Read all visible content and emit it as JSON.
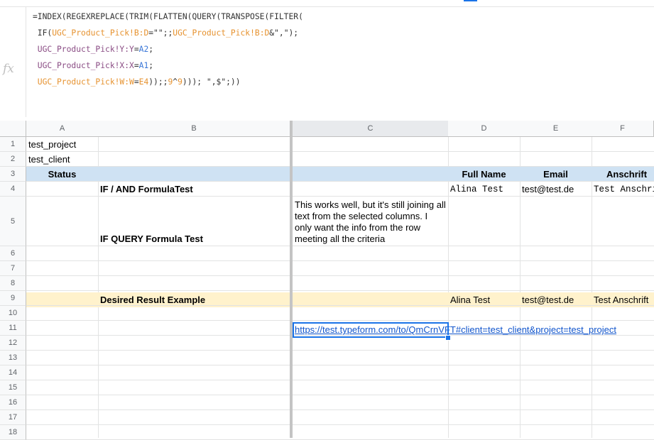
{
  "formula": {
    "fx_label": "fx",
    "lines": [
      [
        {
          "t": "=INDEX(REGEXREPLACE(TRIM(FLATTEN(QUERY(TRANSPOSE(FILTER(",
          "c": "txt"
        }
      ],
      [
        {
          "t": " IF(",
          "c": "txt"
        },
        {
          "t": "UGC_Product_Pick!B:D",
          "c": "org"
        },
        {
          "t": "=\"\";;",
          "c": "txt"
        },
        {
          "t": "UGC_Product_Pick!B:D",
          "c": "org"
        },
        {
          "t": "&\",\");",
          "c": "txt"
        }
      ],
      [
        {
          "t": " UGC_Product_Pick!Y:Y",
          "c": "pur"
        },
        {
          "t": "=",
          "c": "txt"
        },
        {
          "t": "A2",
          "c": "blu"
        },
        {
          "t": ";",
          "c": "txt"
        }
      ],
      [
        {
          "t": " UGC_Product_Pick!X:X",
          "c": "pur"
        },
        {
          "t": "=",
          "c": "txt"
        },
        {
          "t": "A1",
          "c": "blu"
        },
        {
          "t": ";",
          "c": "txt"
        }
      ],
      [
        {
          "t": " UGC_Product_Pick!W:W",
          "c": "org"
        },
        {
          "t": "=",
          "c": "txt"
        },
        {
          "t": "E4",
          "c": "org"
        },
        {
          "t": "));;",
          "c": "txt"
        },
        {
          "t": "9",
          "c": "org"
        },
        {
          "t": "^",
          "c": "txt"
        },
        {
          "t": "9",
          "c": "org"
        },
        {
          "t": "))); \",$\";))",
          "c": "txt"
        }
      ]
    ]
  },
  "columns": [
    "A",
    "B",
    "C",
    "D",
    "E",
    "F"
  ],
  "rows": [
    "1",
    "2",
    "3",
    "4",
    "5",
    "6",
    "7",
    "8",
    "9",
    "10",
    "11",
    "12",
    "13",
    "14",
    "15",
    "16",
    "17",
    "18"
  ],
  "cells": {
    "A1": "test_project",
    "A2": "test_client",
    "A3": "Status",
    "D3": "Full Name",
    "E3": "Email",
    "F3": "Anschrift",
    "B4": "IF / AND FormulaTest",
    "D4": "Alina Test",
    "E4": "test@test.de",
    "F4": "Test Anschrift",
    "B5": "IF QUERY Formula Test",
    "C5": "This works well, but it's still joining all text from the selected columns. I only want the info from the row meeting all the criteria",
    "B9": "Desired Result Example",
    "D9": "Alina Test",
    "E9": "test@test.de",
    "F9": "Test Anschrift",
    "C11": "https://test.typeform.com/to/QmCrnVFT#client=test_client&project=test_project"
  },
  "colors": {
    "header_band": "#cfe2f3",
    "result_band": "#fff2cc",
    "selection": "#1a73e8",
    "link": "#1155cc"
  }
}
